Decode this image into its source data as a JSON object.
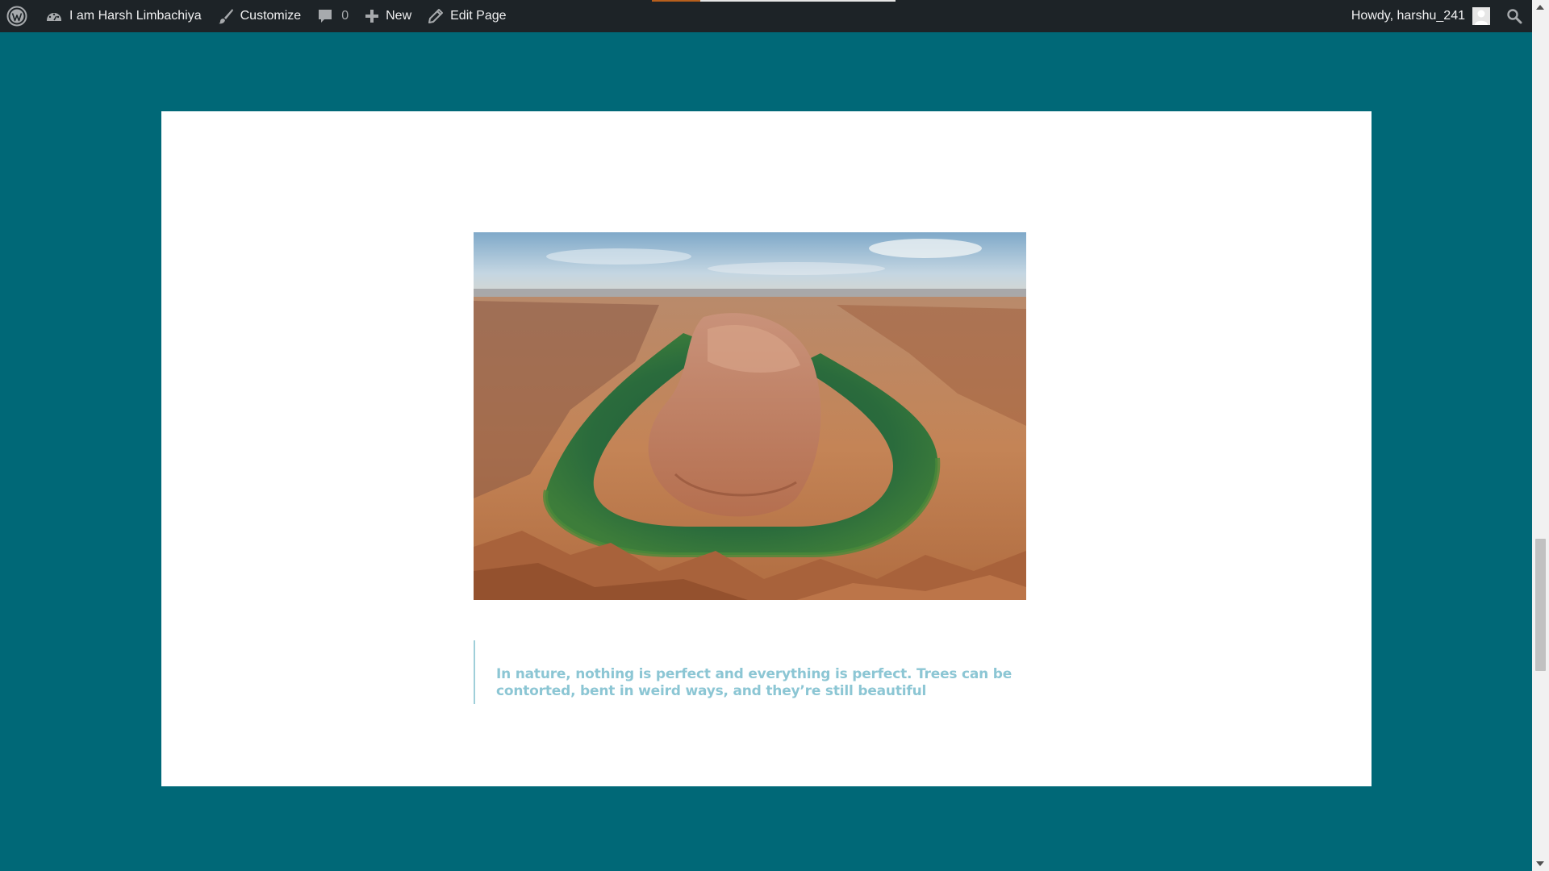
{
  "adminbar": {
    "site_name": "I am Harsh Limbachiya",
    "customize_label": "Customize",
    "comments_count": "0",
    "new_label": "New",
    "edit_label": "Edit Page",
    "greeting": "Howdy, harshu_241",
    "icons": {
      "logo": "wordpress-logo-icon",
      "dashboard": "dashboard-gauge-icon",
      "customize": "paintbrush-icon",
      "comments": "comment-bubble-icon",
      "new": "plus-icon",
      "edit": "pencil-icon",
      "avatar": "user-avatar-icon",
      "search": "search-icon"
    }
  },
  "content": {
    "image": {
      "alt_subject": "horseshoe-bend-canyon-river-photo"
    },
    "quote": {
      "text": "In nature, nothing is perfect and everything is perfect. Trees can be contorted, bent in weird ways, and they’re still beautiful"
    }
  },
  "colors": {
    "page_background": "#006877",
    "adminbar_background": "#1d2327",
    "card_background": "#ffffff",
    "quote_text": "#8cc6d4",
    "quote_border": "#9fcfd9"
  }
}
